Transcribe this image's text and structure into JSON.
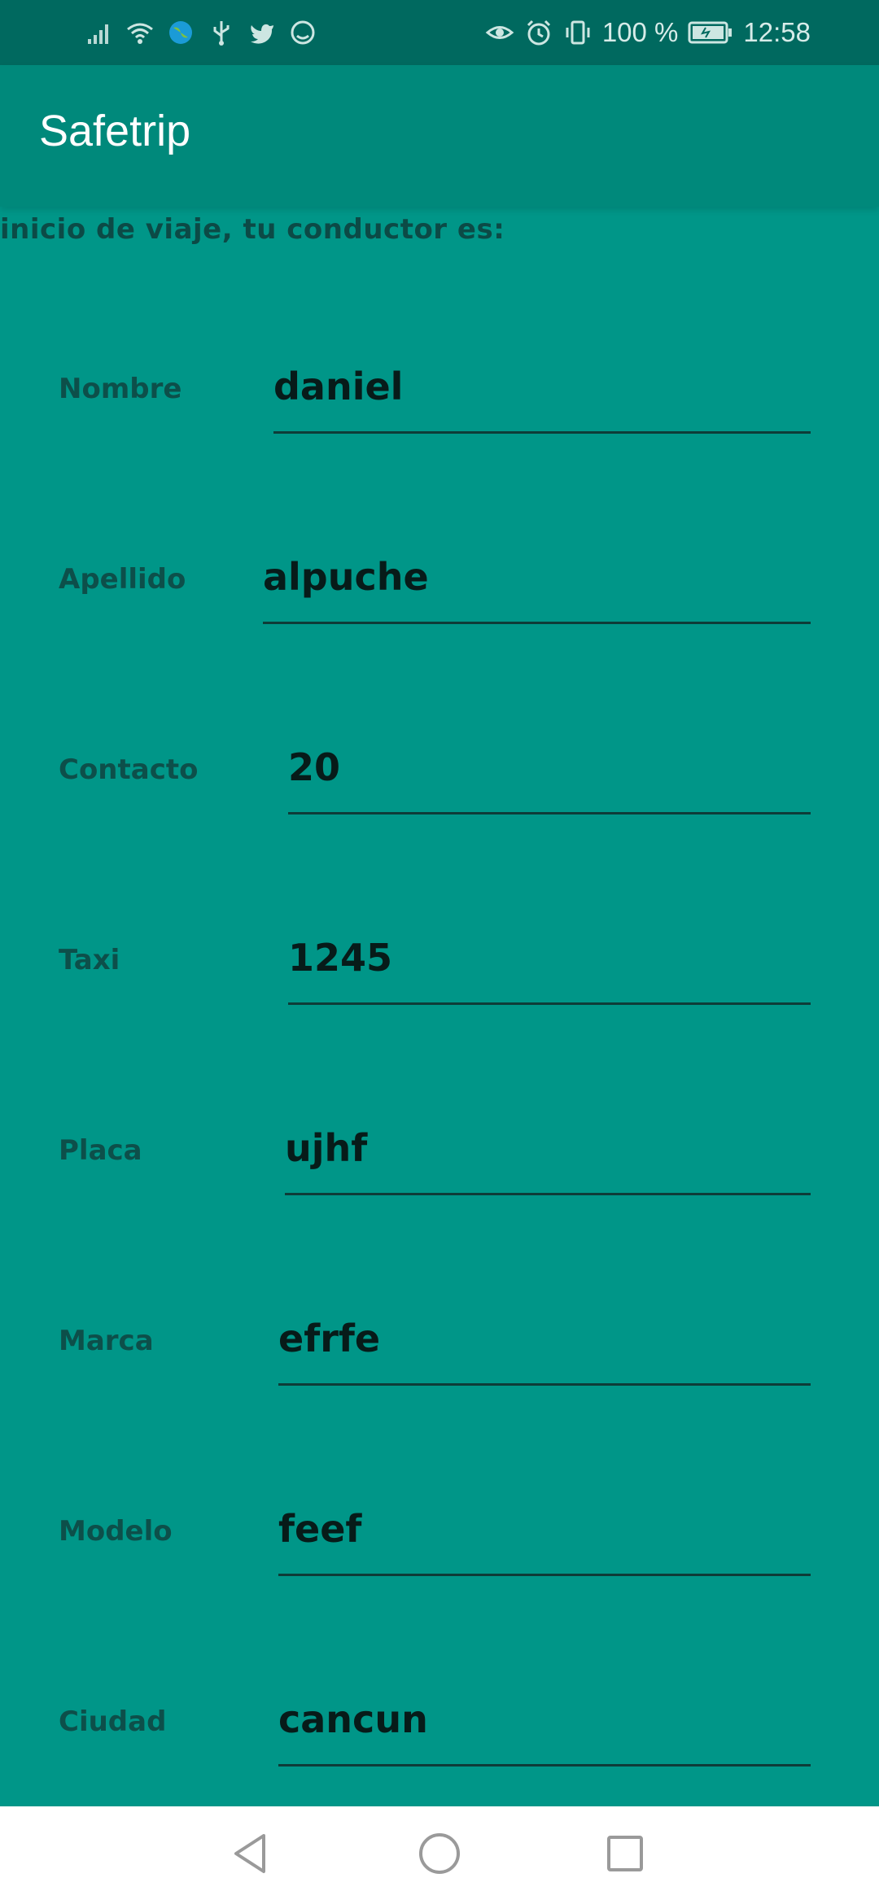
{
  "status_bar": {
    "battery_text": "100 %",
    "time": "12:58",
    "left_icons": [
      "signal-icon",
      "wifi-icon",
      "globe-icon",
      "usb-icon",
      "twitter-icon",
      "sync-icon"
    ],
    "right_icons": [
      "eye-icon",
      "alarm-icon",
      "vibrate-icon",
      "battery-icon"
    ]
  },
  "app_bar": {
    "title": "Safetrip"
  },
  "main": {
    "intro": "inicio de viaje, tu conductor es:",
    "fields": [
      {
        "label": "Nombre",
        "value": "daniel"
      },
      {
        "label": "Apellido",
        "value": "alpuche"
      },
      {
        "label": "Contacto",
        "value": "20"
      },
      {
        "label": "Taxi",
        "value": "1245"
      },
      {
        "label": "Placa",
        "value": "ujhf"
      },
      {
        "label": "Marca",
        "value": "efrfe"
      },
      {
        "label": "Modelo",
        "value": "feef"
      },
      {
        "label": "Ciudad",
        "value": "cancun"
      }
    ]
  },
  "nav_bar": {
    "buttons": [
      "back-icon",
      "home-icon",
      "recents-icon"
    ]
  },
  "colors": {
    "background": "#009688",
    "app_bar": "#00897b",
    "status_bar": "#00695f"
  }
}
